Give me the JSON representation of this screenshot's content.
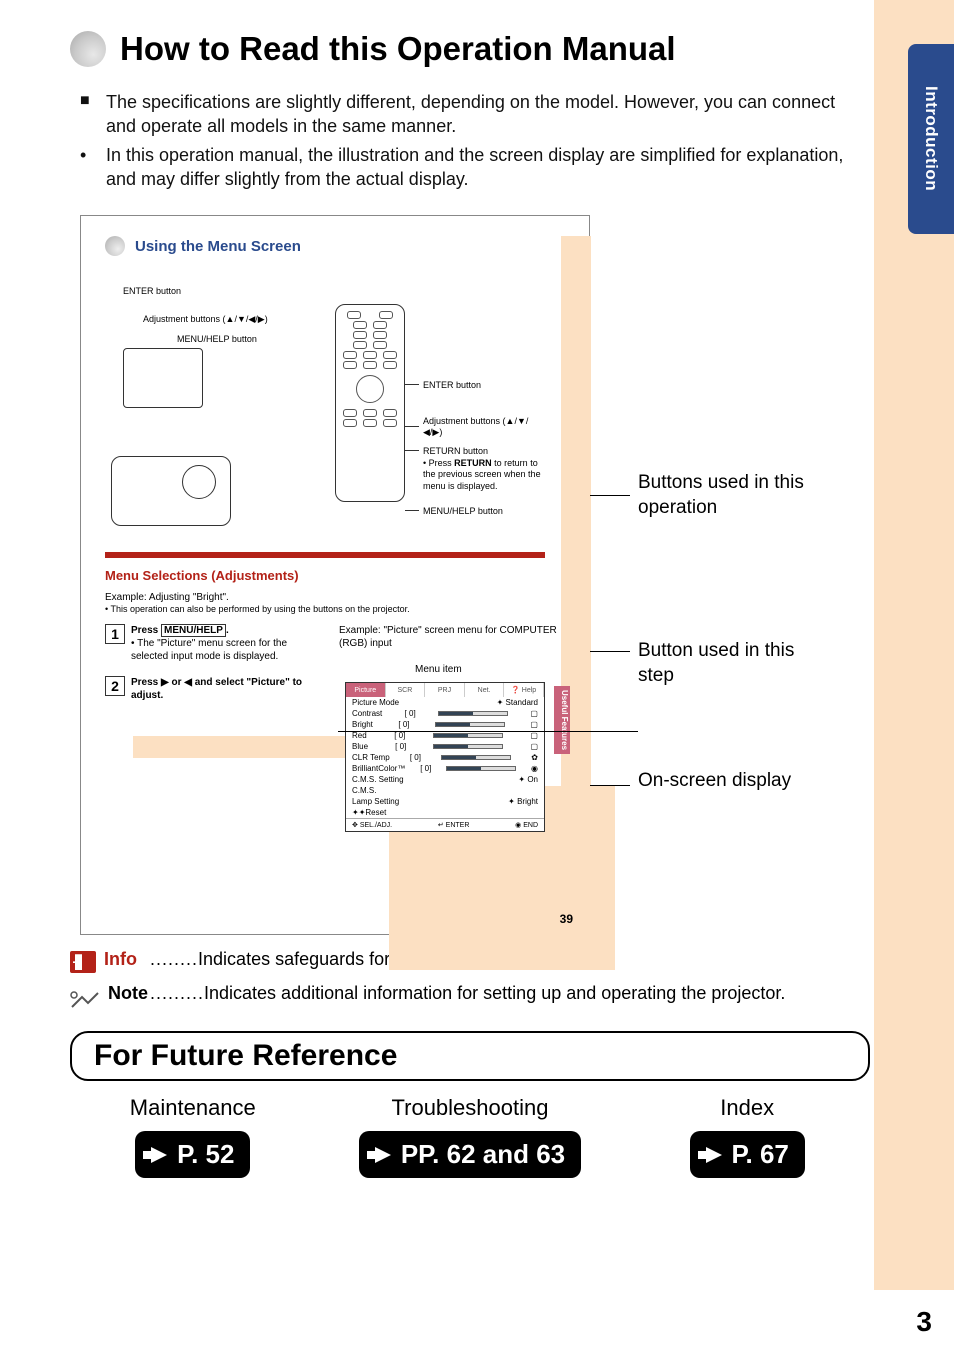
{
  "side_tab": "Introduction",
  "title": "How to Read this Operation Manual",
  "intro": [
    {
      "bullet": "■",
      "text": "The specifications are slightly different, depending on the model. However, you can connect and operate all models in the same manner."
    },
    {
      "bullet": "•",
      "text": "In this operation manual, the illustration and the screen display are simplified for explanation, and may differ slightly from the actual display."
    }
  ],
  "example": {
    "heading": "Using the Menu Screen",
    "labels": {
      "enter": "ENTER button",
      "adjust": "Adjustment buttons (▲/▼/◀/▶)",
      "menu_help": "MENU/HELP button",
      "return": "RETURN button",
      "return_desc": "Press RETURN to return to the previous screen when the menu is displayed."
    },
    "section_title": "Menu Selections (Adjustments)",
    "example_line1": "Example: Adjusting \"Bright\".",
    "example_line2": "• This operation can also be performed by using the buttons on the projector.",
    "steps": [
      {
        "num": "1",
        "title": "Press MENU/HELP.",
        "sub": "• The \"Picture\" menu screen for the selected input mode is displayed."
      },
      {
        "num": "2",
        "title": "Press ▶ or ◀ and select \"Picture\" to adjust.",
        "sub": ""
      }
    ],
    "osd_caption": "Example: \"Picture\" screen menu for COMPUTER (RGB) input",
    "menu_item_label": "Menu item",
    "osd": {
      "tabs": [
        "Picture",
        "SCR",
        "PRJ",
        "Net.",
        "❓ Help"
      ],
      "mode_row": {
        "label": "Picture Mode",
        "value": "Standard"
      },
      "rows": [
        "Contrast",
        "Bright",
        "Red",
        "Blue",
        "CLR Temp",
        "BrilliantColor™"
      ],
      "extra_rows": [
        {
          "label": "C.M.S. Setting",
          "value": "On"
        },
        {
          "label": "C.M.S.",
          "value": ""
        },
        {
          "label": "Lamp Setting",
          "value": "Bright"
        },
        {
          "label": "Reset",
          "value": ""
        }
      ],
      "zero": "0",
      "footer": {
        "sel": "SEL./ADJ.",
        "enter": "ENTER",
        "end": "END"
      }
    },
    "side_vert": "Useful Features",
    "page": "39"
  },
  "annots": {
    "buttons": "Buttons used in this operation",
    "step": "Button used in this step",
    "osd": "On-screen display"
  },
  "info": {
    "label": "Info",
    "dots": "........",
    "text": "Indicates safeguards for using the projector."
  },
  "note": {
    "label": "Note",
    "dots": ".........",
    "text": "Indicates additional information for setting up and operating the projector."
  },
  "future": {
    "heading": "For Future Reference",
    "cols": [
      {
        "label": "Maintenance",
        "page": "P. 52"
      },
      {
        "label": "Troubleshooting",
        "page": "PP. 62 and 63"
      },
      {
        "label": "Index",
        "page": "P. 67"
      }
    ]
  },
  "page_number": "3"
}
